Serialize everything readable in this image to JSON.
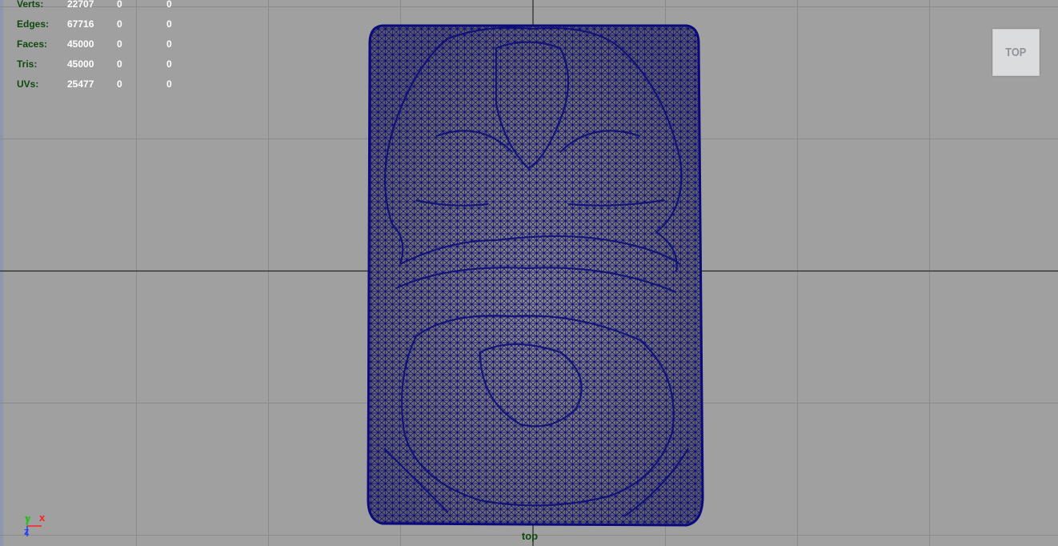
{
  "hud": {
    "rows": [
      {
        "label": "Verts:",
        "v1": "22707",
        "v2": "0",
        "v3": "0"
      },
      {
        "label": "Edges:",
        "v1": "67716",
        "v2": "0",
        "v3": "0"
      },
      {
        "label": "Faces:",
        "v1": "45000",
        "v2": "0",
        "v3": "0"
      },
      {
        "label": "Tris:",
        "v1": "45000",
        "v2": "0",
        "v3": "0"
      },
      {
        "label": "UVs:",
        "v1": "25477",
        "v2": "0",
        "v3": "0"
      }
    ]
  },
  "viewcube": {
    "label": "TOP"
  },
  "camera": {
    "label": "top"
  },
  "axis": {
    "y": "y",
    "x": "x",
    "z": "z"
  },
  "colors": {
    "background": "#a0a0a0",
    "grid": "#8a8a8a",
    "grid_axis": "#2a2a2a",
    "wireframe": "#0a0a7a",
    "surface": "#7c7c7c",
    "hud_label": "#0e4a0e"
  }
}
